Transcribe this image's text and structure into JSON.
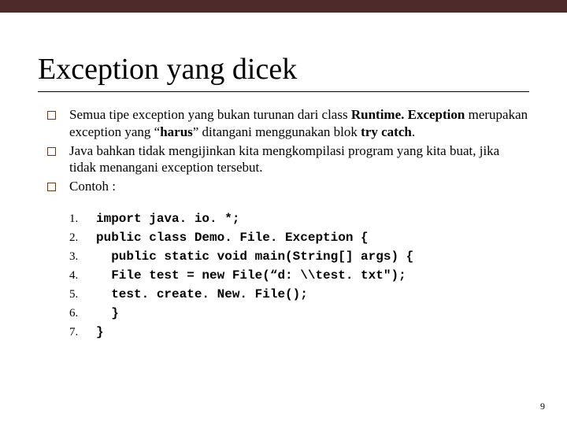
{
  "title": "Exception yang dicek",
  "bullets": [
    {
      "pre1": "Semua tipe exception yang bukan turunan dari class ",
      "b1": "Runtime. Exception",
      "mid1": " merupakan exception yang “",
      "b2": "harus",
      "mid2": "” ditangani menggunakan blok ",
      "b3": "try catch",
      "post": "."
    },
    {
      "text": "Java bahkan tidak mengijinkan kita mengkompilasi program yang kita buat, jika tidak menangani exception tersebut."
    },
    {
      "text": "Contoh :"
    }
  ],
  "code": [
    {
      "n": "1.",
      "line": "import java. io. *;"
    },
    {
      "n": "2.",
      "line": "public class Demo. File. Exception {"
    },
    {
      "n": "3.",
      "line": "  public static void main(String[] args) {"
    },
    {
      "n": "4.",
      "line": "  File test = new File(“d: \\\\test. txt\");"
    },
    {
      "n": "5.",
      "line": "  test. create. New. File();"
    },
    {
      "n": "6.",
      "line": "  }"
    },
    {
      "n": "7.",
      "line": "}"
    }
  ],
  "pagenum": "9"
}
